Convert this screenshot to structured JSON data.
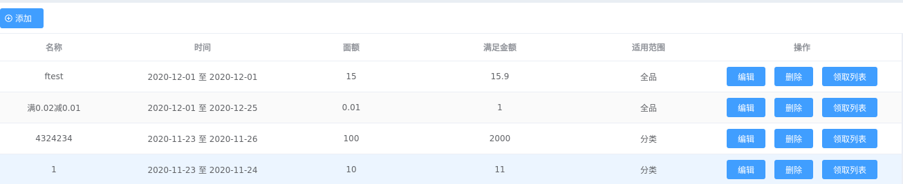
{
  "toolbar": {
    "add_label": "添加",
    "add_icon": "plus-circle-icon"
  },
  "colors": {
    "primary": "#409eff",
    "header_text": "#909399",
    "body_text": "#606266",
    "border": "#ebeef5",
    "stripe": "#fafafa",
    "hover": "#ecf5ff"
  },
  "table": {
    "headers": [
      "名称",
      "时间",
      "面额",
      "满足金额",
      "适用范围",
      "操作"
    ],
    "rows": [
      {
        "name": "ftest",
        "time": "2020-12-01 至 2020-12-01",
        "amount": "15",
        "threshold": "15.9",
        "scope": "全品"
      },
      {
        "name": "满0.02减0.01",
        "time": "2020-12-01 至 2020-12-25",
        "amount": "0.01",
        "threshold": "1",
        "scope": "全品"
      },
      {
        "name": "4324234",
        "time": "2020-11-23 至 2020-11-26",
        "amount": "100",
        "threshold": "2000",
        "scope": "分类"
      },
      {
        "name": "1",
        "time": "2020-11-23 至 2020-11-24",
        "amount": "10",
        "threshold": "11",
        "scope": "分类"
      }
    ],
    "actions": {
      "edit": "编辑",
      "delete": "删除",
      "list": "领取列表"
    }
  }
}
